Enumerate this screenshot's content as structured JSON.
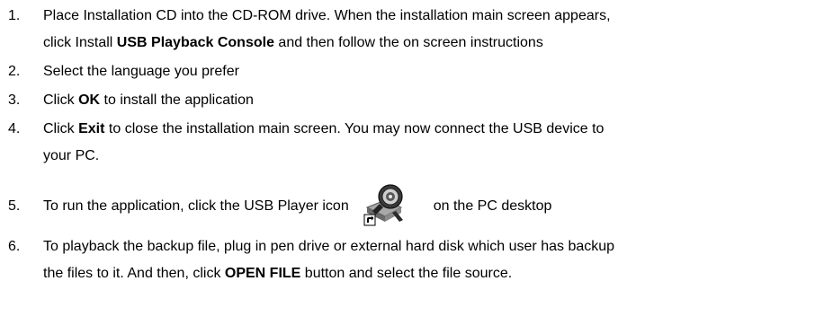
{
  "steps": [
    {
      "num": "1.",
      "line1": "Place Installation CD into the CD-ROM drive. When the installation main screen appears,",
      "line2_a": "click Install ",
      "line2_b": "USB Playback Console",
      "line2_c": " and then follow the on screen instructions"
    },
    {
      "num": "2.",
      "text": "Select the language you prefer"
    },
    {
      "num": "3.",
      "a": "Click ",
      "b": "OK",
      "c": " to install the application"
    },
    {
      "num": "4.",
      "line1_a": "Click ",
      "line1_b": "Exit",
      "line1_c": " to close the installation main screen. You may now connect the USB device to",
      "line2": "your PC."
    },
    {
      "num": "5.",
      "a": "To run the application, click  the USB Player icon",
      "icon": "usb-player-shortcut-icon",
      "c": "on the PC desktop"
    },
    {
      "num": "6.",
      "line1": "To playback the backup file, plug in pen drive or external hard disk which user has backup",
      "line2_a": "the files to it. And then, click ",
      "line2_b": "OPEN FILE",
      "line2_c": " button and select the file source."
    }
  ]
}
